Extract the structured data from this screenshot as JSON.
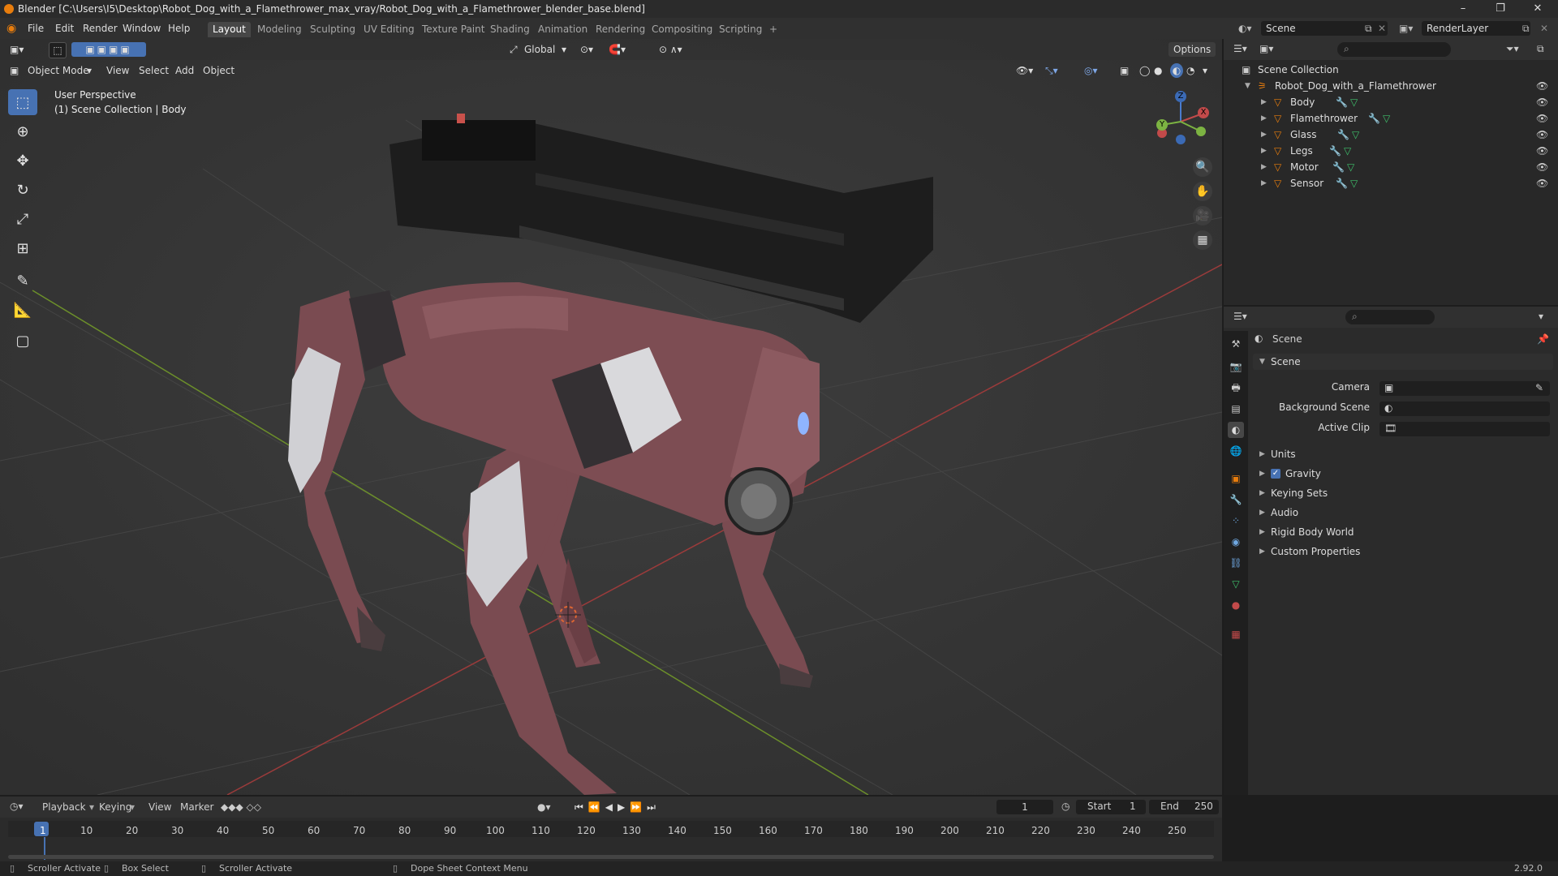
{
  "titlebar": {
    "title": "Blender [C:\\Users\\I5\\Desktop\\Robot_Dog_with_a_Flamethrower_max_vray/Robot_Dog_with_a_Flamethrower_blender_base.blend]",
    "minimize": "–",
    "maximize": "❐",
    "close": "✕"
  },
  "menu": [
    "File",
    "Edit",
    "Render",
    "Window",
    "Help"
  ],
  "workspaces": [
    "Layout",
    "Modeling",
    "Sculpting",
    "UV Editing",
    "Texture Paint",
    "Shading",
    "Animation",
    "Rendering",
    "Compositing",
    "Scripting"
  ],
  "add_workspace": "+",
  "scene_field": "Scene",
  "renderlayer_field": "RenderLayer",
  "viewport": {
    "mode": "Object Mode",
    "menus": [
      "View",
      "Select",
      "Add",
      "Object"
    ],
    "orientation": "Global",
    "options": "Options",
    "info_line1": "User Perspective",
    "info_line2": "(1) Scene Collection | Body",
    "gizmo": {
      "x": "X",
      "y": "Y",
      "z": "Z"
    }
  },
  "outliner": {
    "root": "Scene Collection",
    "collection": "Robot_Dog_with_a_Flamethrower",
    "items": [
      {
        "label": "Body"
      },
      {
        "label": "Flamethrower"
      },
      {
        "label": "Glass"
      },
      {
        "label": "Legs"
      },
      {
        "label": "Motor"
      },
      {
        "label": "Sensor"
      }
    ]
  },
  "properties": {
    "header": "Scene",
    "panel": "Scene",
    "camera_label": "Camera",
    "background_label": "Background Scene",
    "clip_label": "Active Clip",
    "sections": [
      "Units",
      "Gravity",
      "Keying Sets",
      "Audio",
      "Rigid Body World",
      "Custom Properties"
    ],
    "gravity_checked": true
  },
  "timeline": {
    "menus": [
      "Playback",
      "Keying",
      "View",
      "Marker"
    ],
    "current_frame": "1",
    "start_label": "Start",
    "start": "1",
    "end_label": "End",
    "end": "250",
    "ticks": [
      "1",
      "10",
      "20",
      "30",
      "40",
      "50",
      "60",
      "70",
      "80",
      "90",
      "100",
      "110",
      "120",
      "130",
      "140",
      "150",
      "160",
      "170",
      "180",
      "190",
      "200",
      "210",
      "220",
      "230",
      "240",
      "250"
    ]
  },
  "statusbar": {
    "items": [
      "Scroller Activate",
      "Box Select",
      "Scroller Activate",
      "Dope Sheet Context Menu"
    ],
    "version": "2.92.0"
  },
  "colors": {
    "accent": "#4772b3",
    "header": "#303030",
    "viewport_bg": "#393939",
    "object_orange": "#e87d0d",
    "robot_body": "#7a4b51"
  }
}
